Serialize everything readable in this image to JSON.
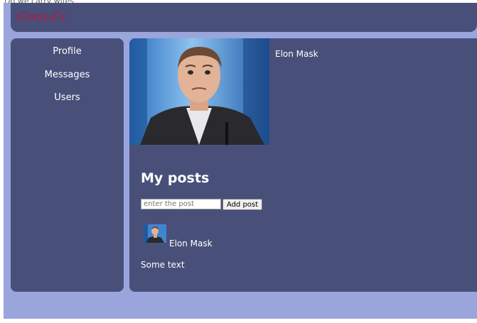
{
  "window": {
    "top_strip_text": "Do we carry wifes"
  },
  "header": {
    "logo_text": "Coca-Cola",
    "logo_color": "#c8102e"
  },
  "sidebar": {
    "items": [
      {
        "label": "Profile"
      },
      {
        "label": "Messages"
      },
      {
        "label": "Users"
      }
    ]
  },
  "profile": {
    "name": "Elon Mask"
  },
  "posts": {
    "title": "My posts",
    "input_placeholder": "enter the post",
    "add_label": "Add post",
    "items": [
      {
        "author": "Elon Mask",
        "text": "Some text"
      }
    ]
  },
  "colors": {
    "background": "#9aa5dc",
    "panel": "#48507a",
    "text": "#ffffff"
  }
}
